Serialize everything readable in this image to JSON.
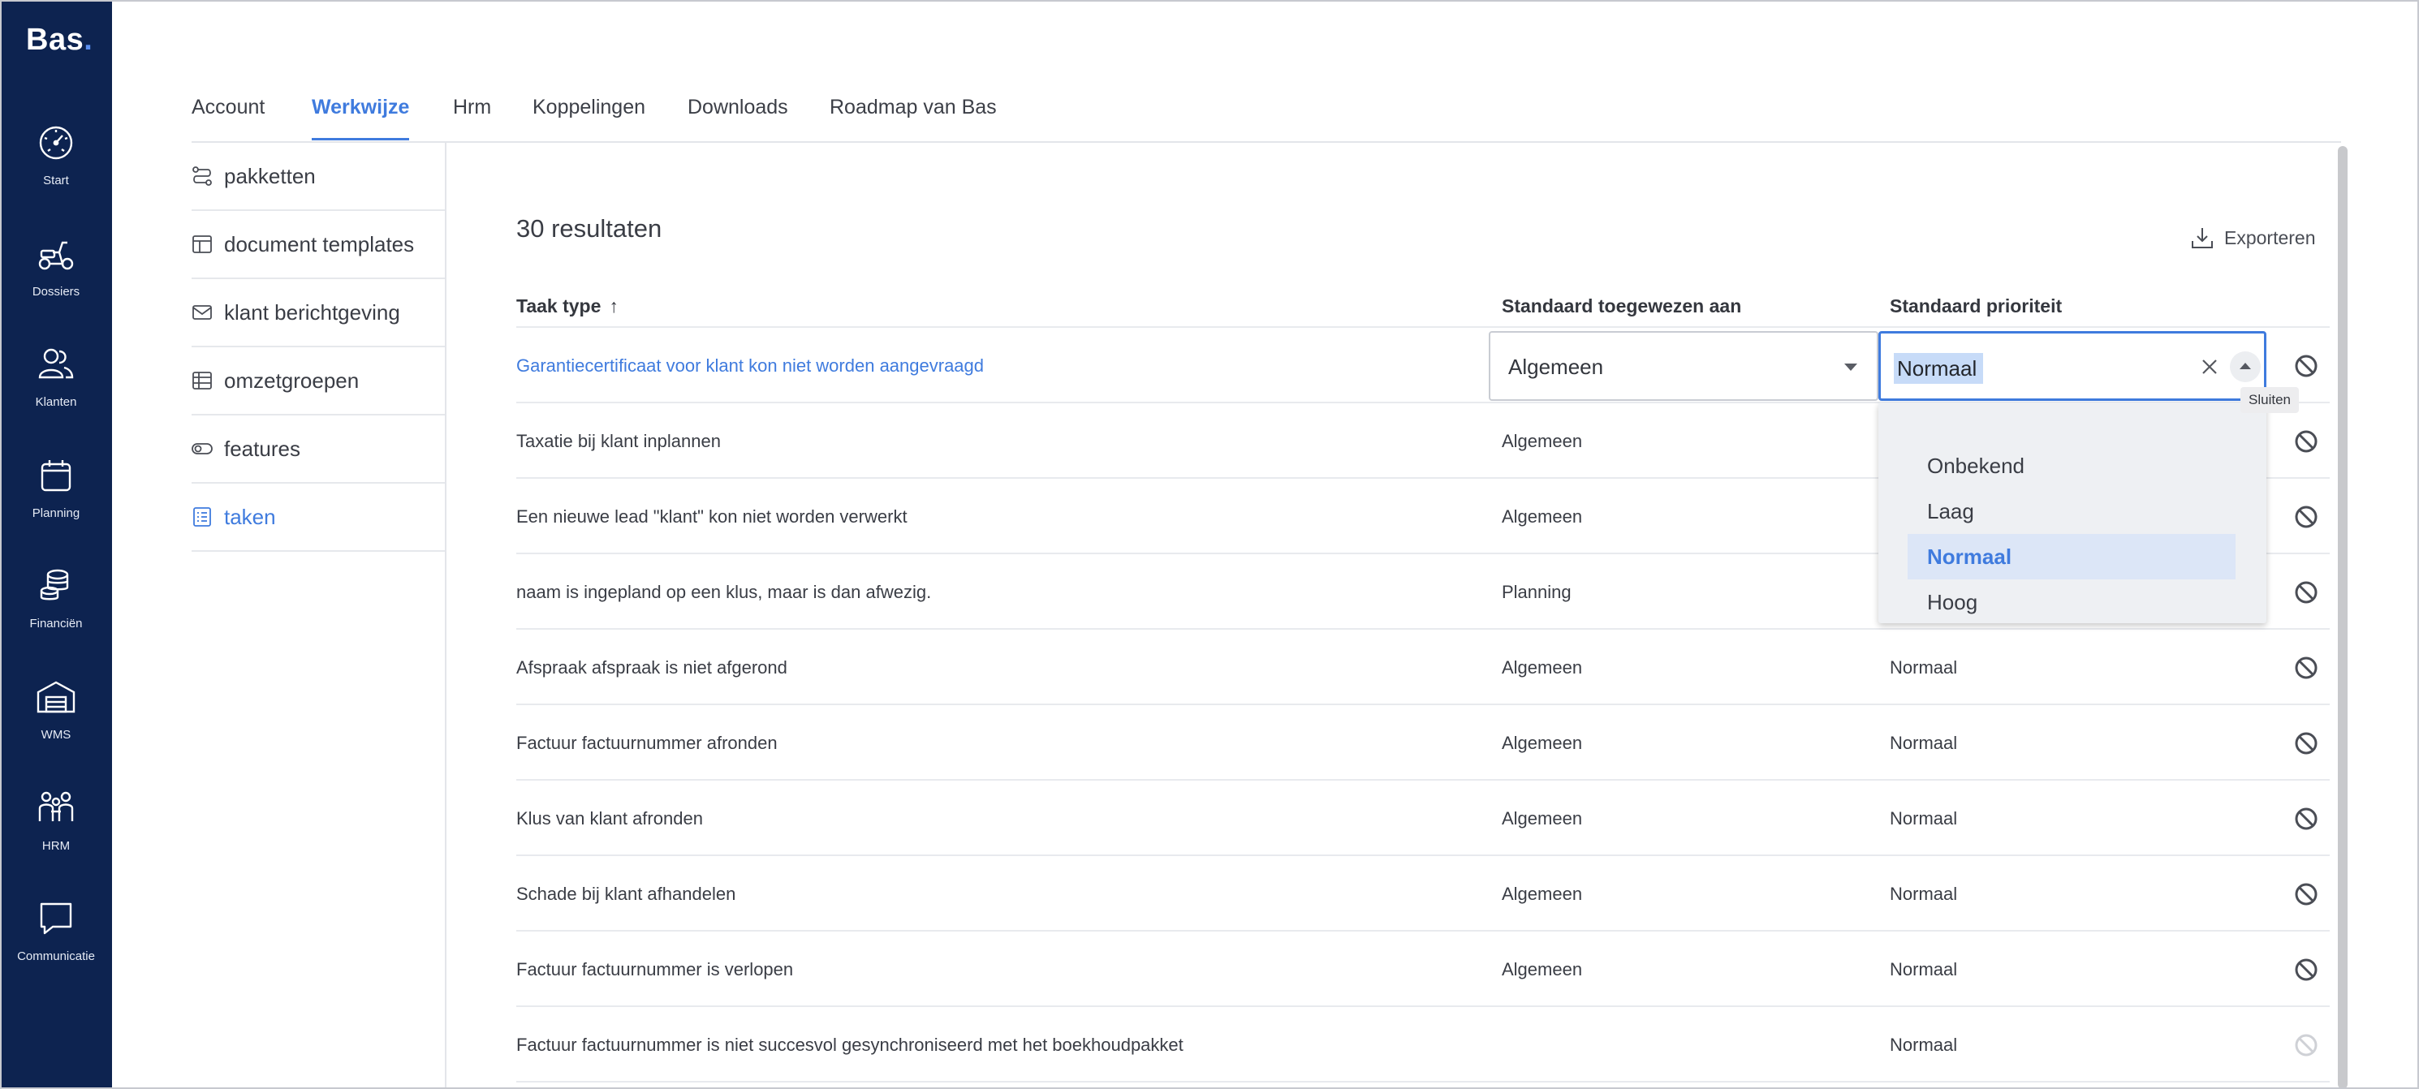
{
  "brand": {
    "name": "Bas",
    "dot": "."
  },
  "nav": [
    {
      "label": "Start",
      "icon": "speedometer-icon"
    },
    {
      "label": "Dossiers",
      "icon": "scooter-icon"
    },
    {
      "label": "Klanten",
      "icon": "customers-icon"
    },
    {
      "label": "Planning",
      "icon": "calendar-icon"
    },
    {
      "label": "Financiën",
      "icon": "coins-icon"
    },
    {
      "label": "WMS",
      "icon": "warehouse-icon"
    },
    {
      "label": "HRM",
      "icon": "people-icon"
    },
    {
      "label": "Communicatie",
      "icon": "chat-icon"
    }
  ],
  "tabs": [
    "Account",
    "Werkwijze",
    "Hrm",
    "Koppelingen",
    "Downloads",
    "Roadmap van Bas"
  ],
  "active_tab": "Werkwijze",
  "submenu": [
    {
      "label": "pakketten",
      "icon": "route-icon"
    },
    {
      "label": "document templates",
      "icon": "template-icon"
    },
    {
      "label": "klant berichtgeving",
      "icon": "envelope-icon"
    },
    {
      "label": "omzetgroepen",
      "icon": "table-icon"
    },
    {
      "label": "features",
      "icon": "toggle-icon"
    },
    {
      "label": "taken",
      "icon": "checklist-icon"
    }
  ],
  "active_submenu": "taken",
  "results_label": "30 resultaten",
  "export_label": "Exporteren",
  "table": {
    "headers": [
      "Taak type",
      "Standaard toegewezen aan",
      "Standaard prioriteit"
    ],
    "sort_indicator": "↑",
    "rows": [
      {
        "task": "Garantiecertificaat voor klant kon niet worden aangevraagd",
        "assigned": "Algemeen",
        "priority": "Normaal"
      },
      {
        "task": "Taxatie bij klant inplannen",
        "assigned": "Algemeen",
        "priority": ""
      },
      {
        "task": "Een nieuwe lead \"klant\" kon niet worden verwerkt",
        "assigned": "Algemeen",
        "priority": ""
      },
      {
        "task": "naam is ingepland op een klus, maar is dan afwezig.",
        "assigned": "Planning",
        "priority": ""
      },
      {
        "task": "Afspraak afspraak is niet afgerond",
        "assigned": "Algemeen",
        "priority": "Normaal"
      },
      {
        "task": "Factuur factuurnummer afronden",
        "assigned": "Algemeen",
        "priority": "Normaal"
      },
      {
        "task": "Klus van klant afronden",
        "assigned": "Algemeen",
        "priority": "Normaal"
      },
      {
        "task": "Schade bij klant afhandelen",
        "assigned": "Algemeen",
        "priority": "Normaal"
      },
      {
        "task": "Factuur factuurnummer is verlopen",
        "assigned": "Algemeen",
        "priority": "Normaal"
      },
      {
        "task": "Factuur factuurnummer is niet succesvol gesynchroniseerd met het boekhoudpakket",
        "assigned": "",
        "priority": "Normaal"
      }
    ]
  },
  "assigned_select": {
    "value": "Algemeen"
  },
  "priority_select": {
    "value": "Normaal",
    "options": [
      "Onbekend",
      "Laag",
      "Normaal",
      "Hoog"
    ],
    "selected": "Normaal"
  },
  "tooltip": "Sluiten",
  "colors": {
    "sidebar": "#0d2350",
    "accent": "#3f7bde",
    "selection": "#c7dbf8"
  }
}
